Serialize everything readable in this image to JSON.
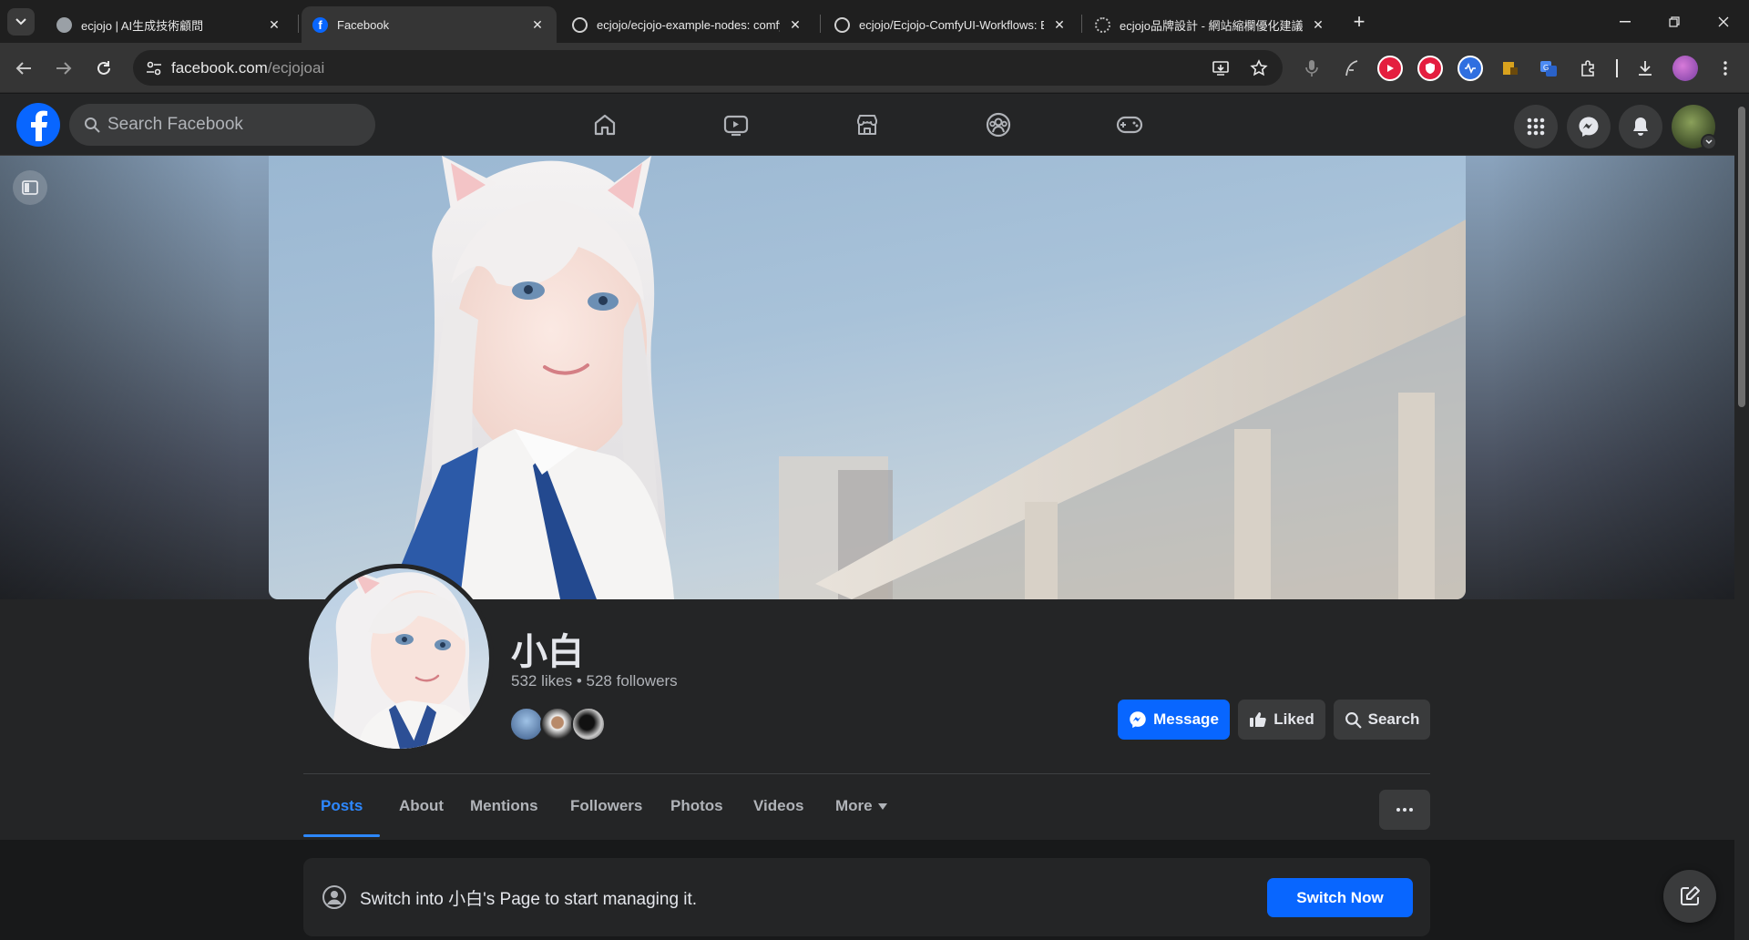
{
  "browser": {
    "tabs": [
      {
        "title": "ecjojo | AI生成技術顧問",
        "active": false
      },
      {
        "title": "Facebook",
        "active": true
      },
      {
        "title": "ecjojo/ecjojo-example-nodes: comfyu",
        "active": false
      },
      {
        "title": "ecjojo/Ecjojo-ComfyUI-Workflows: Ec",
        "active": false
      },
      {
        "title": "ecjojo品牌設計 - 網站縮欄優化建議",
        "active": false
      }
    ],
    "url_host": "facebook.com",
    "url_path": "/ecjojoai"
  },
  "fb": {
    "search_placeholder": "Search Facebook",
    "brand_color": "#0866ff"
  },
  "profile": {
    "name": "小白",
    "likes": "532 likes",
    "sep": " • ",
    "followers": "528 followers",
    "buttons": {
      "message": "Message",
      "liked": "Liked",
      "search": "Search"
    },
    "tabs": [
      "Posts",
      "About",
      "Mentions",
      "Followers",
      "Photos",
      "Videos",
      "More"
    ],
    "active_tab": "Posts"
  },
  "switch_card": {
    "text": "Switch into 小白's Page to start managing it.",
    "button": "Switch Now"
  }
}
